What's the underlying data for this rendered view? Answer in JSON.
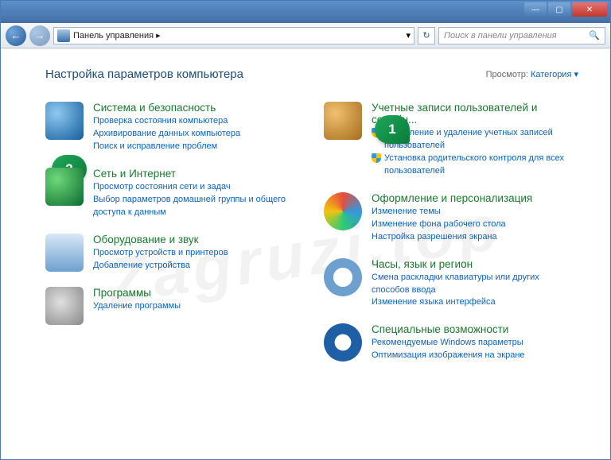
{
  "titlebar": {
    "min": "—",
    "max": "▢",
    "close": "✕"
  },
  "nav": {
    "back": "←",
    "fwd": "→",
    "breadcrumb": "Панель управления  ▸",
    "refresh": "↻",
    "search_placeholder": "Поиск в панели управления"
  },
  "header": {
    "title": "Настройка параметров компьютера",
    "view_label": "Просмотр:",
    "view_value": "Категория ▾"
  },
  "callouts": {
    "one": "1",
    "two": "2"
  },
  "left": [
    {
      "title": "Система и безопасность",
      "links": [
        "Проверка состояния компьютера",
        "Архивирование данных компьютера",
        "Поиск и исправление проблем"
      ],
      "icon": "ico-sys"
    },
    {
      "title": "Сеть и Интернет",
      "links": [
        "Просмотр состояния сети и задач",
        "Выбор параметров домашней группы и общего доступа к данным"
      ],
      "icon": "ico-net"
    },
    {
      "title": "Оборудование и звук",
      "links": [
        "Просмотр устройств и принтеров",
        "Добавление устройства"
      ],
      "icon": "ico-hw"
    },
    {
      "title": "Программы",
      "links": [
        "Удаление программы"
      ],
      "icon": "ico-prog"
    }
  ],
  "right": [
    {
      "title": "Учетные записи пользователей и семейн...",
      "links": [
        "Добавление и удаление учетных записей пользователей",
        "Установка родительского контроля для всех пользователей"
      ],
      "shields": [
        true,
        true
      ],
      "icon": "ico-user"
    },
    {
      "title": "Оформление и персонализация",
      "links": [
        "Изменение темы",
        "Изменение фона рабочего стола",
        "Настройка разрешения экрана"
      ],
      "icon": "ico-pers"
    },
    {
      "title": "Часы, язык и регион",
      "links": [
        "Смена раскладки клавиатуры или других способов ввода",
        "Изменение языка интерфейса"
      ],
      "icon": "ico-clock"
    },
    {
      "title": "Специальные возможности",
      "links": [
        "Рекомендуемые Windows параметры",
        "Оптимизация изображения на экране"
      ],
      "icon": "ico-ease"
    }
  ],
  "watermark": "Zagruzi.top"
}
